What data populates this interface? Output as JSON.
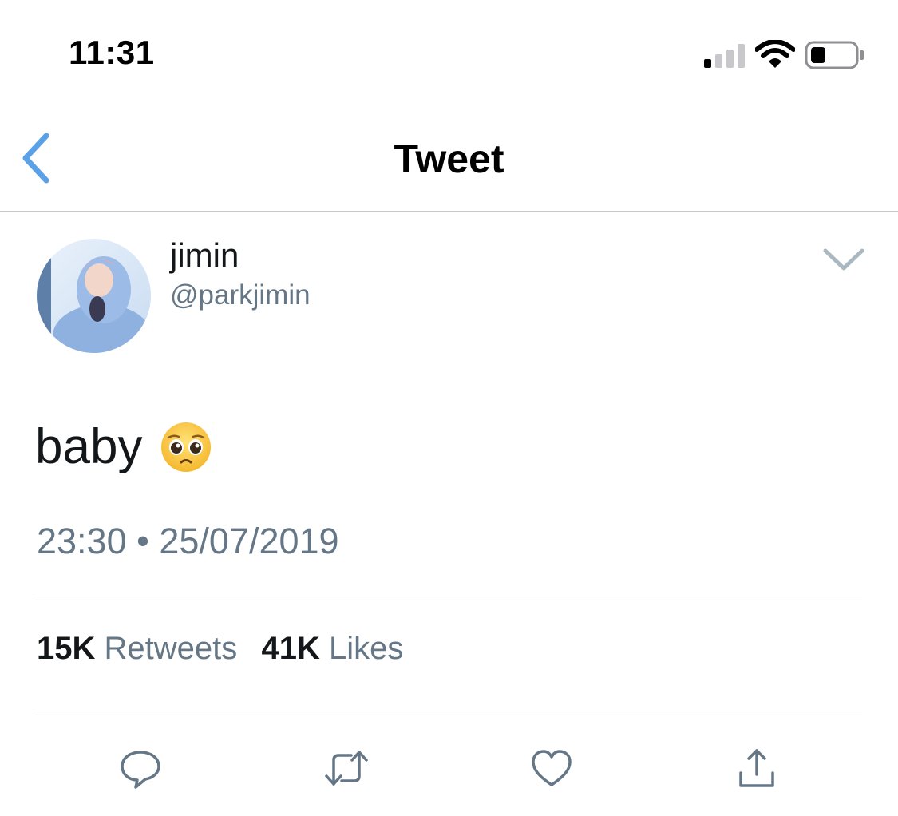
{
  "status_bar": {
    "time": "11:31",
    "icons": [
      "signal-icon",
      "wifi-icon",
      "battery-icon"
    ]
  },
  "nav": {
    "title": "Tweet",
    "back_icon": "chevron-left-icon",
    "accent_color": "#5aa1e8"
  },
  "tweet": {
    "author": {
      "name": "jimin",
      "handle": "@parkjimin"
    },
    "text": "baby",
    "emoji": "pleading-face-emoji",
    "timestamp": "23:30 • 25/07/2019",
    "stats": {
      "retweets_count": "15K",
      "retweets_label": "Retweets",
      "likes_count": "41K",
      "likes_label": "Likes"
    }
  },
  "actions": [
    "reply-icon",
    "retweet-icon",
    "like-icon",
    "share-icon"
  ],
  "colors": {
    "primary_text": "#14171a",
    "secondary_text": "#657786",
    "divider": "#d6dbdf"
  }
}
